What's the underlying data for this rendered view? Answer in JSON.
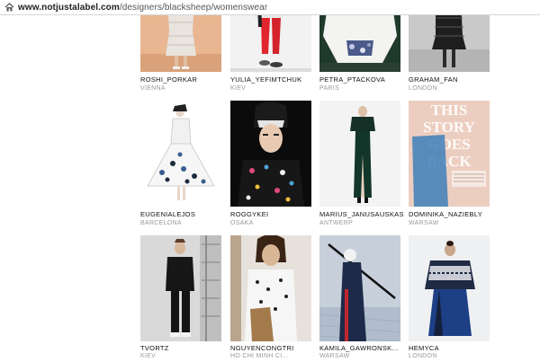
{
  "browser": {
    "url_host": "www.notjustalabel.com",
    "url_path": "/designers/blacksheep/womenswear"
  },
  "icons": {
    "home": "home-icon"
  },
  "designers": [
    {
      "name": "ROSHI_PORKAR",
      "city": "VIENNA"
    },
    {
      "name": "YULIA_YEFIMTCHUK",
      "city": "KIEV"
    },
    {
      "name": "PETRA_PTACKOVA",
      "city": "PARIS"
    },
    {
      "name": "GRAHAM_FAN",
      "city": "LONDON"
    },
    {
      "name": "EUGENIALEJOS",
      "city": "BARCELONA"
    },
    {
      "name": "ROGGYKEI",
      "city": "OSAKA"
    },
    {
      "name": "MARIUS_JANUSAUSKAS",
      "city": "ANTWERP"
    },
    {
      "name": "DOMINIKA_NAZIEBLY",
      "city": "WARSAW"
    },
    {
      "name": "TVORTZ",
      "city": "KIEV"
    },
    {
      "name": "NGUYENCONGTRI",
      "city": "HO CHI MINH CI..."
    },
    {
      "name": "KAMILA_GAWRONSK...",
      "city": "WARSAW"
    },
    {
      "name": "HEMYCA",
      "city": "LONDON"
    }
  ],
  "magazine_cover_text": [
    "THIS",
    "STORY",
    "GOES",
    "BACK"
  ]
}
